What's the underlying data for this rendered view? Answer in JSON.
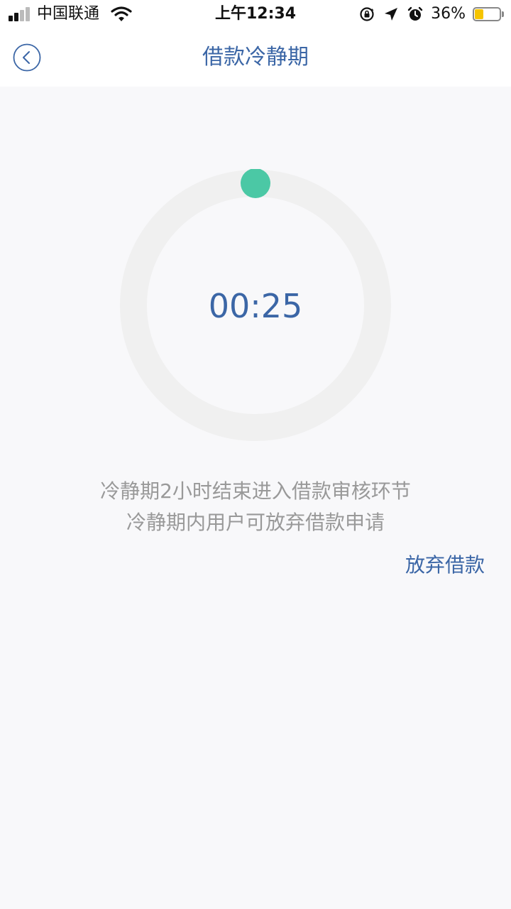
{
  "status_bar": {
    "carrier": "中国联通",
    "time": "上午12:34",
    "battery_percent": "36%",
    "battery_level": 0.36,
    "battery_color": "#f5c400",
    "icons": [
      "signal-icon",
      "wifi-icon",
      "orientation-lock-icon",
      "location-icon",
      "alarm-icon",
      "battery-icon"
    ]
  },
  "nav": {
    "back_icon": "chevron-left-icon",
    "title": "借款冷静期"
  },
  "countdown": {
    "value": "00:25",
    "progress": 0.0,
    "track_color": "#f0f0f0",
    "indicator_color": "#4bc8a5"
  },
  "description": {
    "line1": "冷静期2小时结束进入借款审核环节",
    "line2": "冷静期内用户可放弃借款申请"
  },
  "actions": {
    "abandon_label": "放弃借款"
  },
  "colors": {
    "accent": "#3b66a6",
    "muted_text": "#999999",
    "background": "#f8f8fa"
  }
}
